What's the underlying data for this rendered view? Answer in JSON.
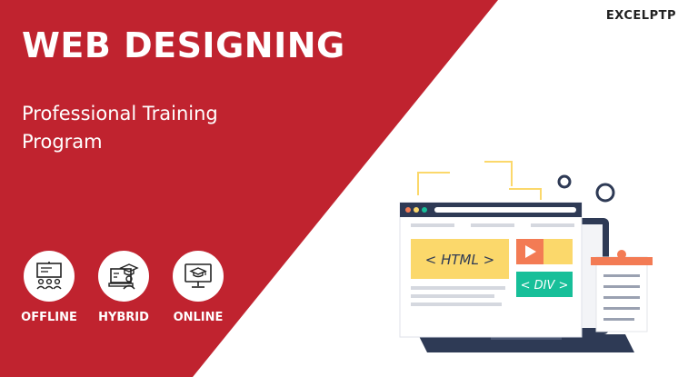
{
  "brand": "EXCELPTP",
  "title": "WEB DESIGNING",
  "subtitle": "Professional Training Program",
  "modes": [
    {
      "label": "OFFLINE",
      "icon": "classroom-icon"
    },
    {
      "label": "HYBRID",
      "icon": "computer-graduate-icon"
    },
    {
      "label": "ONLINE",
      "icon": "monitor-graduation-cap-icon"
    }
  ],
  "illustration": {
    "html_tag": "< HTML >",
    "div_tag": "< DIV >"
  },
  "colors": {
    "brand_red": "#c0232f",
    "white": "#ffffff",
    "yellow": "#fbd86b",
    "orange": "#f37b54",
    "teal": "#17bf99",
    "dark_navy": "#2e3a55"
  }
}
